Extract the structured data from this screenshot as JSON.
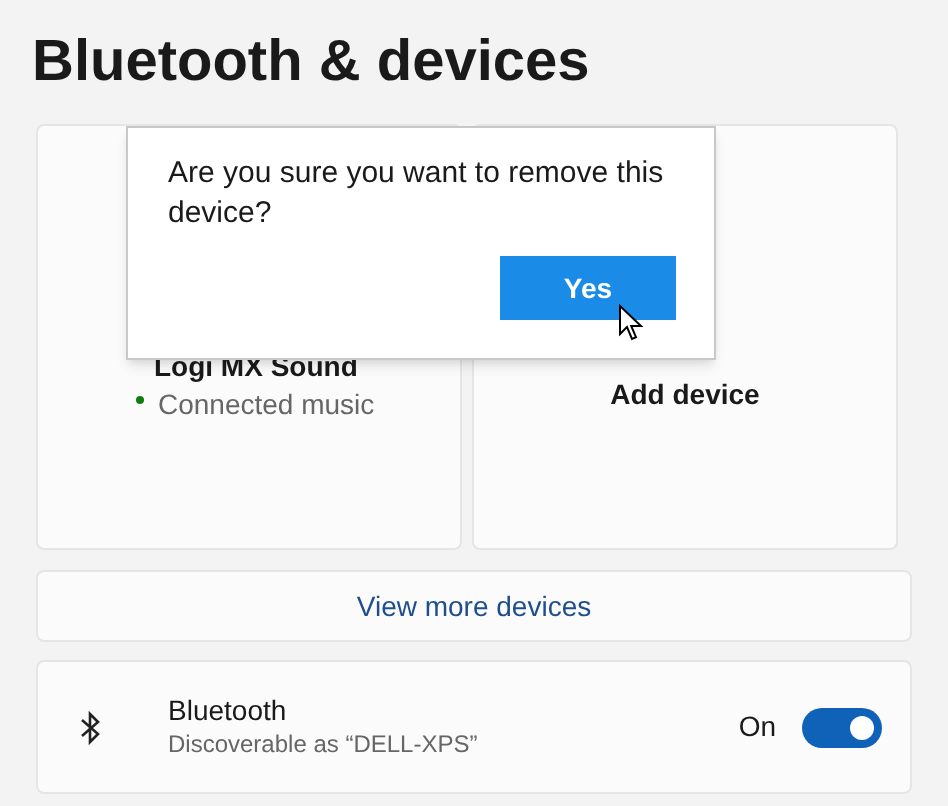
{
  "title": "Bluetooth & devices",
  "devices": [
    {
      "kind": "device",
      "name": "Logi MX Sound",
      "status": "Connected music",
      "color": "#107c10"
    },
    {
      "kind": "add",
      "name": "Add device"
    }
  ],
  "view_more": "View more devices",
  "bluetooth": {
    "name": "Bluetooth",
    "description": "Discoverable as “DELL-XPS”",
    "state_label": "On",
    "on": true
  },
  "dialog": {
    "message": "Are you sure you want to remove this device?",
    "buttons": [
      "Yes"
    ]
  }
}
